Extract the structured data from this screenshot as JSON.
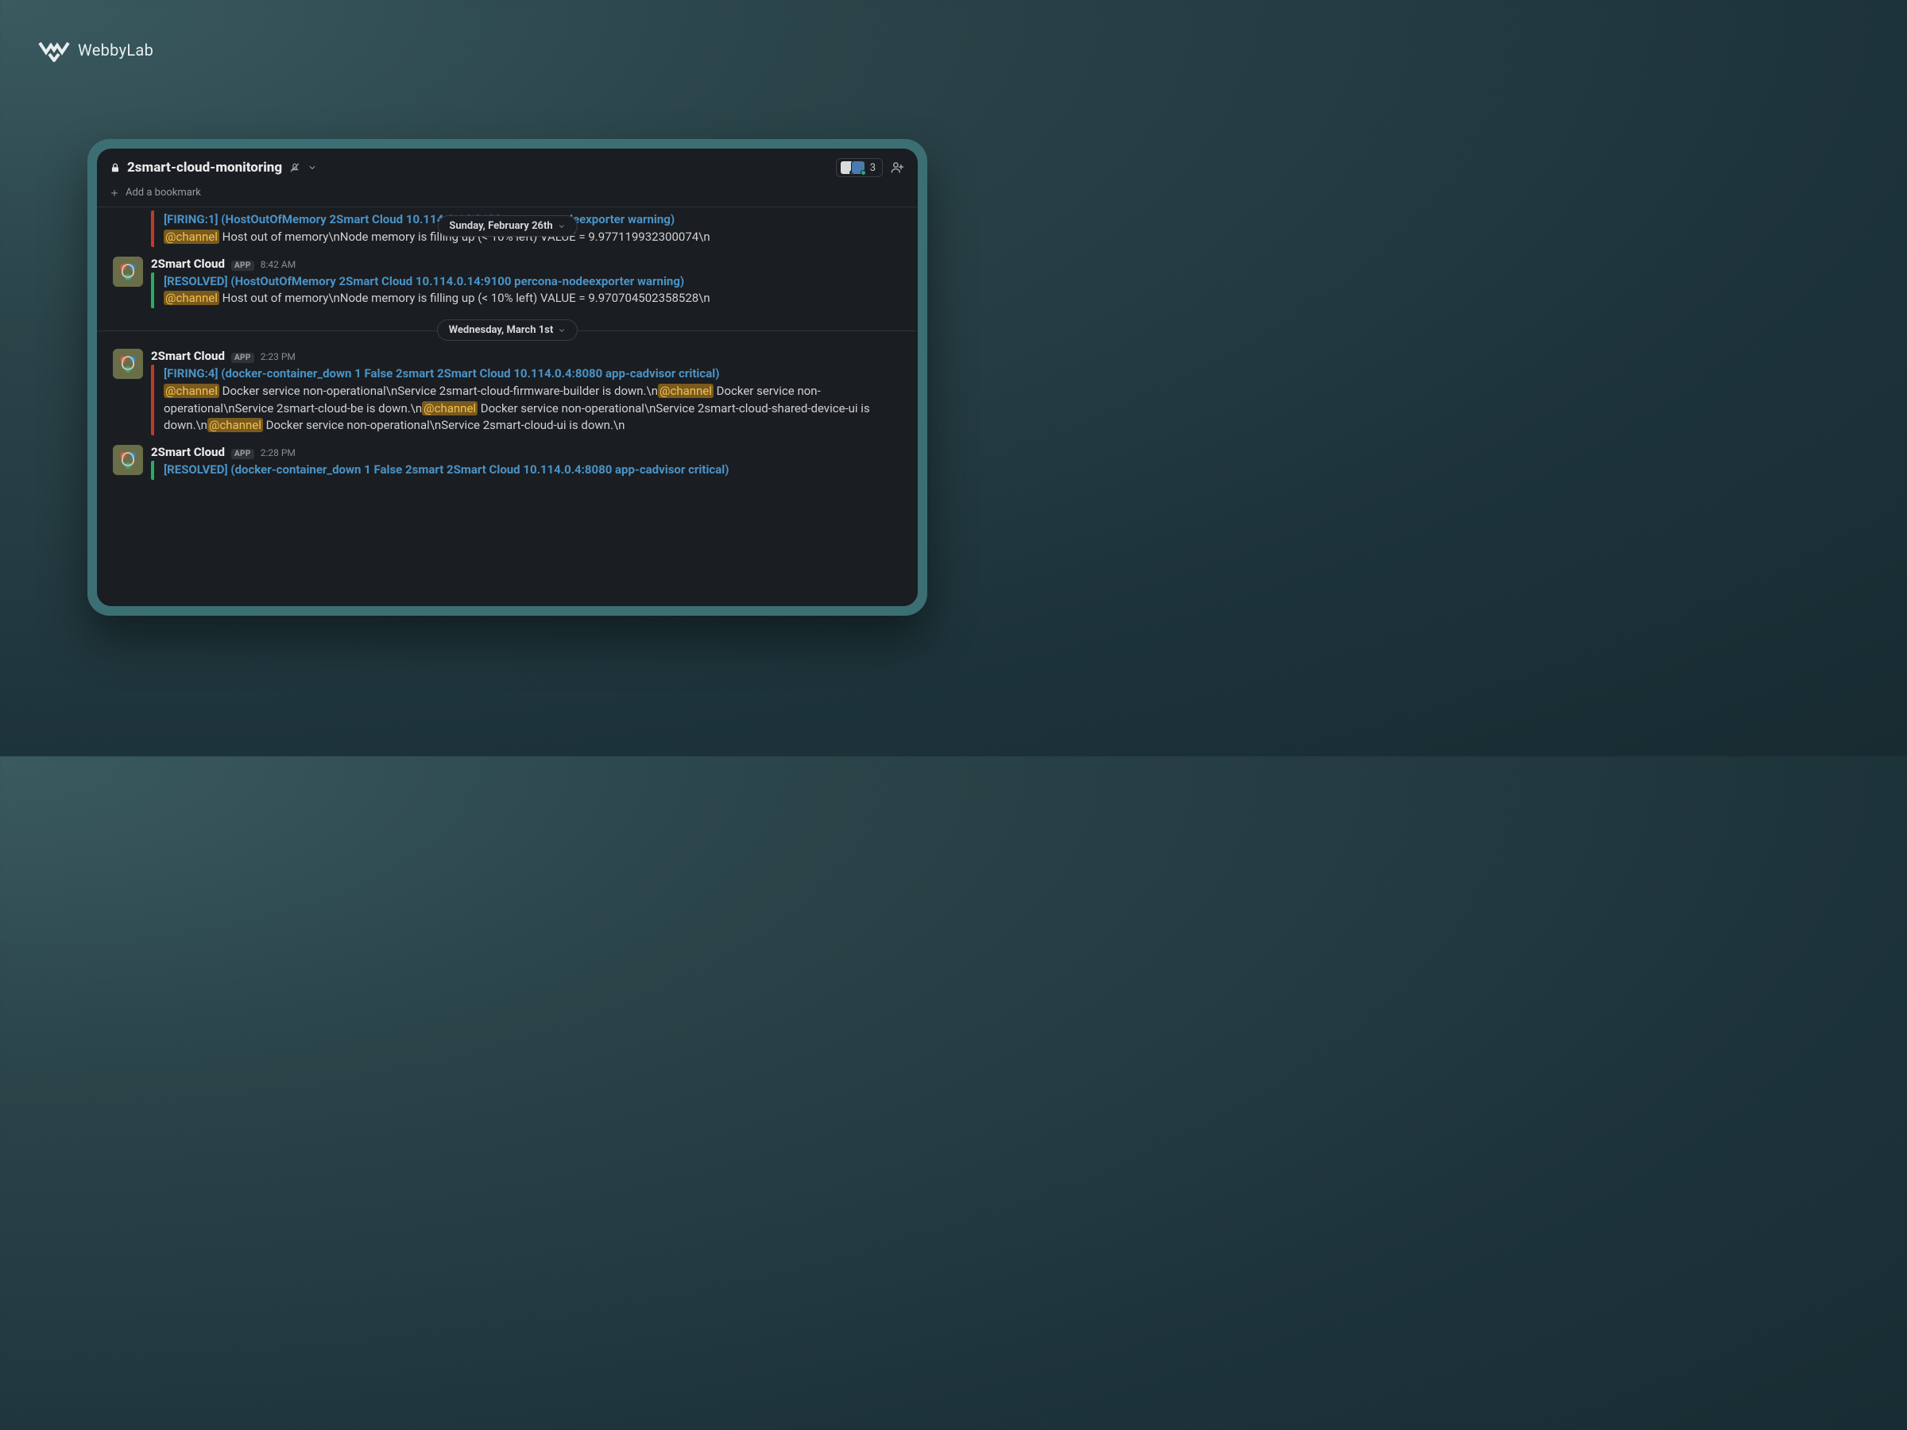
{
  "brand": "WebbyLab",
  "channel": {
    "name": "2smart-cloud-monitoring",
    "is_private": true,
    "notifications_muted": true,
    "member_count": "3",
    "bookmark_prompt": "Add a bookmark"
  },
  "date_pills": {
    "feb26": "Sunday, February 26th",
    "mar1": "Wednesday, March 1st"
  },
  "app_badge": "APP",
  "mention": "@channel",
  "messages": [
    {
      "author": "2Smart Cloud",
      "time": "8:42 AM",
      "status": "firing",
      "title": "[FIRING:1]  (HostOutOfMemory 2Smart Cloud 10.114.0.14:9100 percona-nodeexporter warning)",
      "segments": [
        {
          "t": "mention"
        },
        {
          "t": "text",
          "v": " Host out of memory\\nNode memory is filling up (< 10% left)  VALUE = 9.977119932300074\\n"
        }
      ]
    },
    {
      "author": "2Smart Cloud",
      "time": "8:42 AM",
      "status": "resolved",
      "title": "[RESOLVED]  (HostOutOfMemory 2Smart Cloud 10.114.0.14:9100 percona-nodeexporter warning)",
      "segments": [
        {
          "t": "mention"
        },
        {
          "t": "text",
          "v": " Host out of memory\\nNode memory is filling up (< 10% left)  VALUE = 9.970704502358528\\n"
        }
      ]
    },
    {
      "author": "2Smart Cloud",
      "time": "2:23 PM",
      "status": "firing",
      "title": "[FIRING:4]  (docker-container_down 1 False 2smart 2Smart Cloud 10.114.0.4:8080 app-cadvisor critical)",
      "segments": [
        {
          "t": "mention"
        },
        {
          "t": "text",
          "v": " Docker service non-operational\\nService 2smart-cloud-firmware-builder is down.\\n"
        },
        {
          "t": "mention"
        },
        {
          "t": "text",
          "v": " Docker service non-operational\\nService 2smart-cloud-be is down.\\n"
        },
        {
          "t": "mention"
        },
        {
          "t": "text",
          "v": " Docker service non-operational\\nService 2smart-cloud-shared-device-ui is down.\\n"
        },
        {
          "t": "mention"
        },
        {
          "t": "text",
          "v": " Docker service non-operational\\nService 2smart-cloud-ui is down.\\n"
        }
      ]
    },
    {
      "author": "2Smart Cloud",
      "time": "2:28 PM",
      "status": "resolved",
      "title": "[RESOLVED]  (docker-container_down 1 False 2smart 2Smart Cloud 10.114.0.4:8080 app-cadvisor critical)",
      "segments": []
    }
  ]
}
